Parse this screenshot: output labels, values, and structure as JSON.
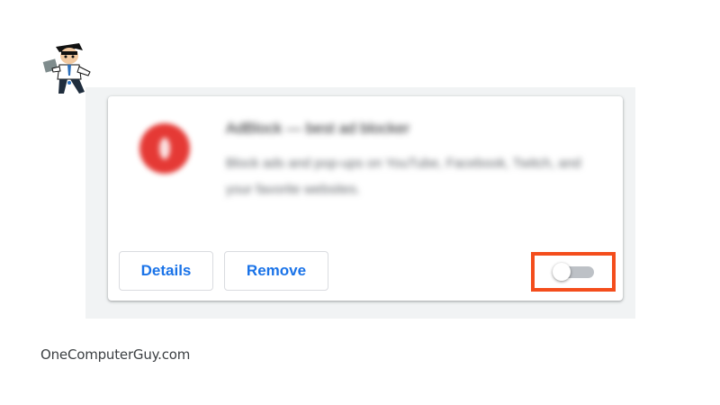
{
  "extension": {
    "name": "AdBlock — best ad blocker",
    "description": "Block ads and pop-ups on YouTube, Facebook, Twitch, and your favorite websites.",
    "enabled": false
  },
  "buttons": {
    "details": "Details",
    "remove": "Remove"
  },
  "watermark": "OneComputerGuy.com",
  "colors": {
    "accent": "#1a73e8",
    "highlight": "#f44d1c",
    "icon": "#e53935"
  }
}
